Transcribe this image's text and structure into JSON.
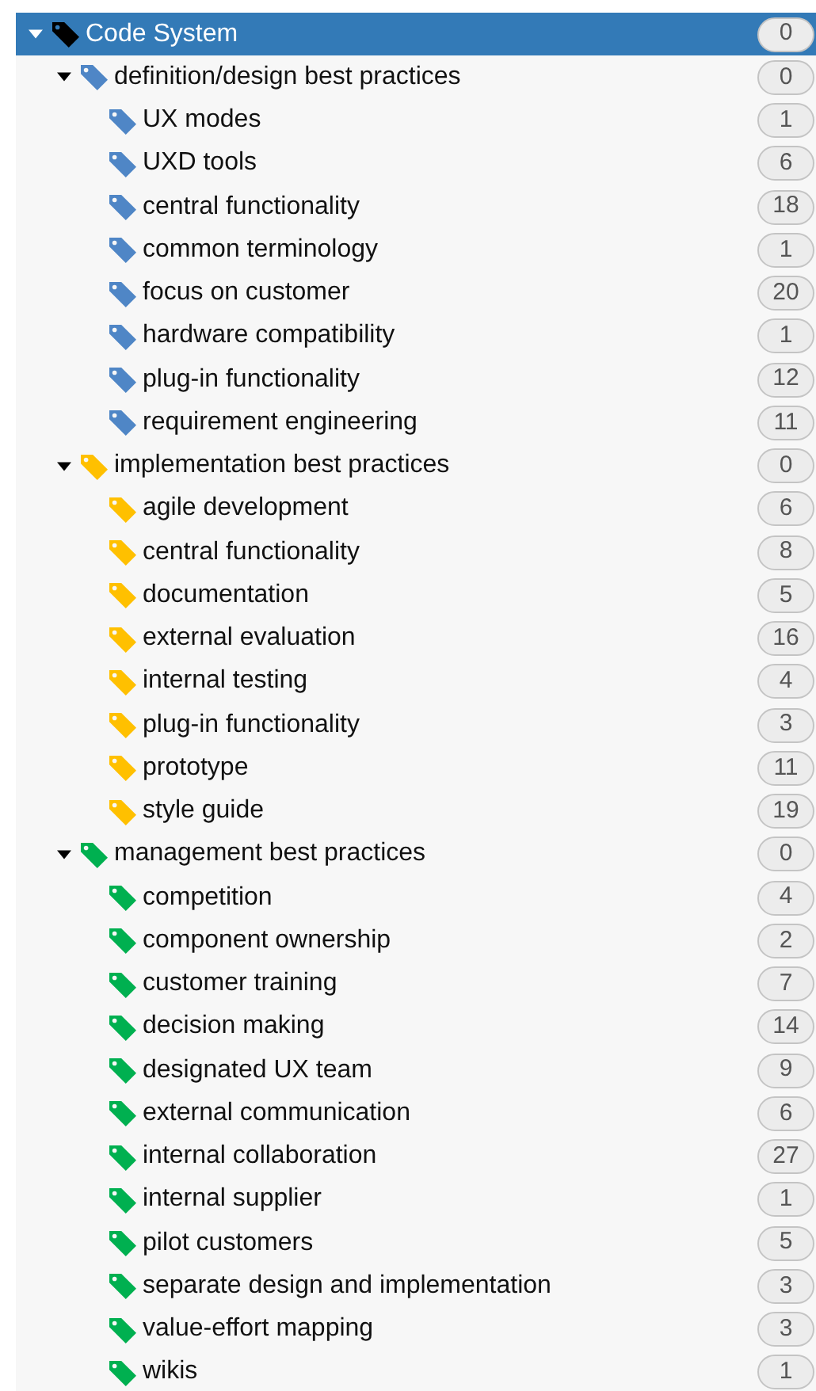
{
  "tree": [
    {
      "label": "Code System",
      "count": "0",
      "color": "#000000",
      "selected": true,
      "expanded": true,
      "children": [
        {
          "label": "definition/design best practices",
          "count": "0",
          "color": "#4f86c6",
          "selected": false,
          "expanded": true,
          "children": [
            {
              "label": "UX modes",
              "count": "1",
              "color": "#4f86c6",
              "selected": false
            },
            {
              "label": "UXD tools",
              "count": "6",
              "color": "#4f86c6",
              "selected": false
            },
            {
              "label": "central functionality",
              "count": "18",
              "color": "#4f86c6",
              "selected": false
            },
            {
              "label": "common terminology",
              "count": "1",
              "color": "#4f86c6",
              "selected": false
            },
            {
              "label": "focus on customer",
              "count": "20",
              "color": "#4f86c6",
              "selected": false
            },
            {
              "label": "hardware compatibility",
              "count": "1",
              "color": "#4f86c6",
              "selected": false
            },
            {
              "label": "plug-in functionality",
              "count": "12",
              "color": "#4f86c6",
              "selected": false
            },
            {
              "label": "requirement engineering",
              "count": "11",
              "color": "#4f86c6",
              "selected": false
            }
          ]
        },
        {
          "label": "implementation best practices",
          "count": "0",
          "color": "#ffc000",
          "selected": false,
          "expanded": true,
          "children": [
            {
              "label": "agile development",
              "count": "6",
              "color": "#ffc000",
              "selected": false
            },
            {
              "label": "central functionality",
              "count": "8",
              "color": "#ffc000",
              "selected": false
            },
            {
              "label": "documentation",
              "count": "5",
              "color": "#ffc000",
              "selected": false
            },
            {
              "label": "external evaluation",
              "count": "16",
              "color": "#ffc000",
              "selected": false
            },
            {
              "label": "internal testing",
              "count": "4",
              "color": "#ffc000",
              "selected": false
            },
            {
              "label": "plug-in functionality",
              "count": "3",
              "color": "#ffc000",
              "selected": false
            },
            {
              "label": "prototype",
              "count": "11",
              "color": "#ffc000",
              "selected": false
            },
            {
              "label": "style guide",
              "count": "19",
              "color": "#ffc000",
              "selected": false
            }
          ]
        },
        {
          "label": "management best practices",
          "count": "0",
          "color": "#00b050",
          "selected": false,
          "expanded": true,
          "children": [
            {
              "label": "competition",
              "count": "4",
              "color": "#00b050",
              "selected": false
            },
            {
              "label": "component ownership",
              "count": "2",
              "color": "#00b050",
              "selected": false
            },
            {
              "label": "customer training",
              "count": "7",
              "color": "#00b050",
              "selected": false
            },
            {
              "label": "decision making",
              "count": "14",
              "color": "#00b050",
              "selected": false
            },
            {
              "label": "designated UX team",
              "count": "9",
              "color": "#00b050",
              "selected": false
            },
            {
              "label": "external communication",
              "count": "6",
              "color": "#00b050",
              "selected": false
            },
            {
              "label": "internal collaboration",
              "count": "27",
              "color": "#00b050",
              "selected": false
            },
            {
              "label": "internal supplier",
              "count": "1",
              "color": "#00b050",
              "selected": false
            },
            {
              "label": "pilot customers",
              "count": "5",
              "color": "#00b050",
              "selected": false
            },
            {
              "label": "separate design and implementation",
              "count": "3",
              "color": "#00b050",
              "selected": false
            },
            {
              "label": "value-effort mapping",
              "count": "3",
              "color": "#00b050",
              "selected": false
            },
            {
              "label": "wikis",
              "count": "1",
              "color": "#00b050",
              "selected": false
            }
          ]
        }
      ]
    }
  ]
}
